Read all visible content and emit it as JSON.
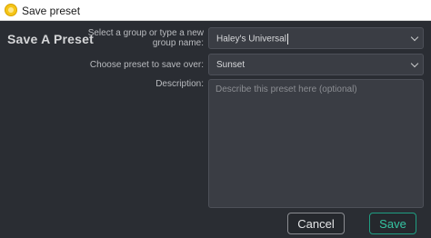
{
  "window": {
    "title": "Save preset",
    "icon": "app-sun-icon"
  },
  "dialog": {
    "heading": "Save A Preset",
    "group": {
      "label_line1": "Select a group or type a new",
      "label_line2": "group name:",
      "value": "Haley's Universal"
    },
    "preset": {
      "label": "Choose preset to save over:",
      "value": "Sunset"
    },
    "description": {
      "label": "Description:",
      "placeholder": "Describe this preset here (optional)",
      "value": ""
    }
  },
  "buttons": {
    "cancel": "Cancel",
    "save": "Save"
  },
  "colors": {
    "background": "#2a2d33",
    "field": "#3a3d44",
    "save_accent": "#35c4a2"
  }
}
